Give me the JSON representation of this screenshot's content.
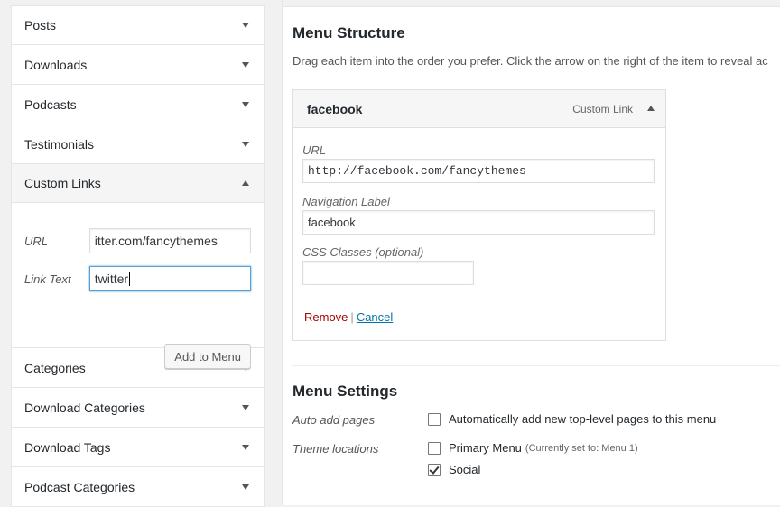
{
  "accordion": {
    "sections_top": [
      {
        "label": "Posts"
      },
      {
        "label": "Downloads"
      },
      {
        "label": "Podcasts"
      },
      {
        "label": "Testimonials"
      }
    ],
    "custom_links": {
      "label": "Custom Links",
      "url_label": "URL",
      "url_value": "itter.com/fancythemes",
      "link_text_label": "Link Text",
      "link_text_value": "twitter",
      "add_button": "Add to Menu"
    },
    "sections_bottom": [
      {
        "label": "Categories"
      },
      {
        "label": "Download Categories"
      },
      {
        "label": "Download Tags"
      },
      {
        "label": "Podcast Categories"
      }
    ]
  },
  "menu_structure": {
    "heading": "Menu Structure",
    "description": "Drag each item into the order you prefer. Click the arrow on the right of the item to reveal ac",
    "item": {
      "title": "facebook",
      "type": "Custom Link",
      "url_label": "URL",
      "url_value": "http://facebook.com/fancythemes",
      "nav_label_label": "Navigation Label",
      "nav_label_value": "facebook",
      "css_label": "CSS Classes (optional)",
      "css_value": "",
      "remove": "Remove",
      "separator": "|",
      "cancel": "Cancel"
    }
  },
  "menu_settings": {
    "heading": "Menu Settings",
    "auto_add_label": "Auto add pages",
    "auto_add_option": "Automatically add new top-level pages to this menu",
    "auto_add_checked": false,
    "theme_locations_label": "Theme locations",
    "locations": [
      {
        "label": "Primary Menu",
        "note": "(Currently set to: Menu 1)",
        "checked": false
      },
      {
        "label": "Social",
        "note": "",
        "checked": true
      }
    ]
  }
}
